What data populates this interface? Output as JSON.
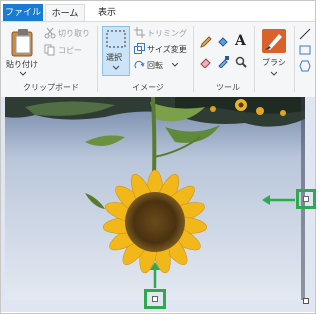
{
  "tabs": {
    "file": "ファイル",
    "home": "ホーム",
    "view": "表示"
  },
  "clipboard": {
    "paste": "貼り付け",
    "cut": "切り取り",
    "copy": "コピー",
    "group": "クリップボード"
  },
  "image": {
    "select": "選択",
    "crop": "トリミング",
    "resize": "サイズ変更",
    "rotate": "回転",
    "group": "イメージ"
  },
  "tools": {
    "group": "ツール",
    "text_icon_glyph": "A"
  },
  "brushes": {
    "label": "ブラシ"
  },
  "colors": {
    "accent": "#1a7bd3",
    "callout": "#2fa84f"
  }
}
